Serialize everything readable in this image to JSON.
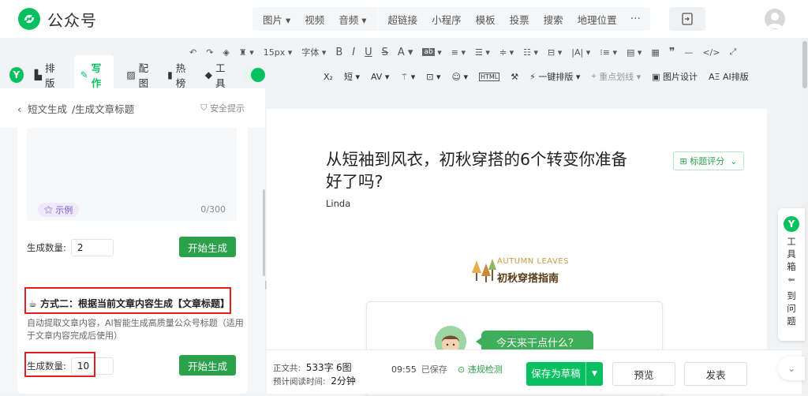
{
  "app": {
    "name": "公众号"
  },
  "topnav": {
    "media": [
      "图片",
      "视频",
      "音频"
    ],
    "insert": [
      "超链接",
      "小程序",
      "模板",
      "投票",
      "搜索",
      "地理位置"
    ],
    "more": "···"
  },
  "toolbar1": {
    "font_size": "15px",
    "font_family": "字体"
  },
  "toolbar2": {
    "one_click": "一键排版",
    "highlight": "重点划线",
    "image_design": "图片设计",
    "ai_layout": "AI排版"
  },
  "lefttabs": [
    "排版",
    "写作",
    "配图",
    "热榜",
    "工具"
  ],
  "leftpanel": {
    "back_label": "短文生成",
    "current": "/生成文章标题",
    "safety_tip": "安全提示",
    "example_label": "示例",
    "counter": "0/300",
    "qty_label": "生成数量:",
    "qty1_value": "2",
    "gen_label": "开始生成",
    "method2_title": "方式二：根据当前文章内容生成【文章标题】",
    "method2_desc": "自动提取文章内容，AI智能生成高质量公众号标题（适用于文章内容完成后使用）",
    "qty2_value": "10"
  },
  "article": {
    "title": "从短袖到风衣，初秋穿搭的6个转变你准备好了吗?",
    "author": "Linda",
    "score_label": "标题评分",
    "banner_en": "AUTUMN LEAVES",
    "banner_cn": "初秋穿搭指南",
    "bubble": "今天来干点什么？"
  },
  "footer": {
    "word_label": "正文共:",
    "word_count": "533字",
    "image_count": "6图",
    "read_label": "预计阅读时间:",
    "read_time": "2分钟",
    "saved_time": "09:55",
    "saved_text": "已保存",
    "check": "违规检测",
    "save_draft": "保存为草稿",
    "preview": "预览",
    "publish": "发表"
  },
  "sidetool": {
    "label": "工具箱",
    "label2": "到问题"
  },
  "colors": {
    "brand": "#07c160",
    "button": "#2aa14a",
    "highlight_box": "#e02020"
  }
}
